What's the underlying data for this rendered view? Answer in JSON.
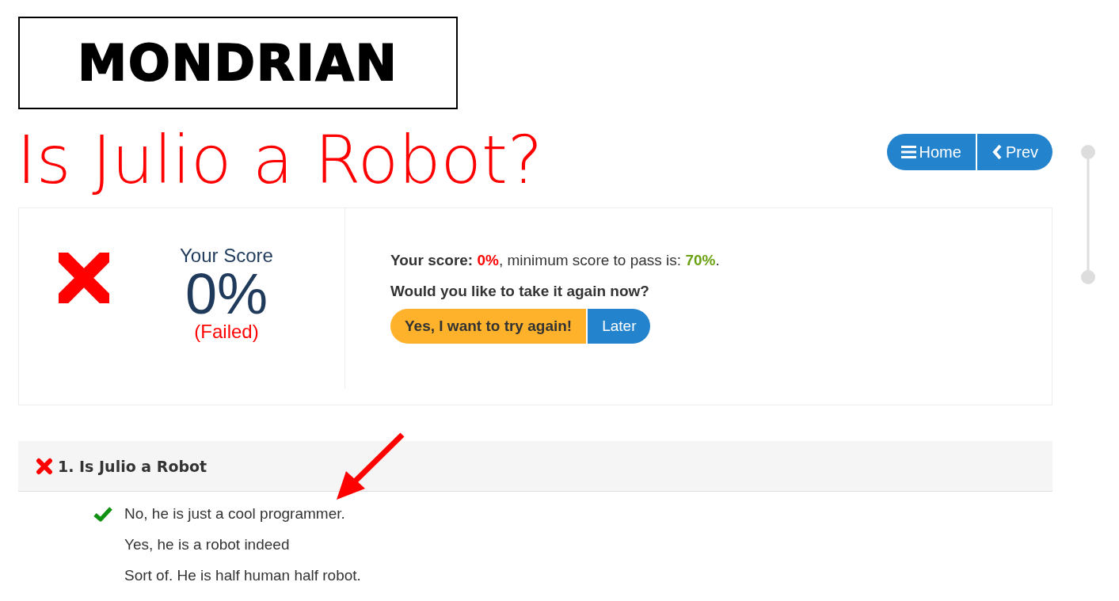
{
  "logo": {
    "text": "MONDRIAN"
  },
  "title": "Is Julio a Robot?",
  "nav_buttons": [
    {
      "kind": "home",
      "label": "Home"
    },
    {
      "kind": "prev",
      "label": "Prev"
    }
  ],
  "result": {
    "passed": false,
    "heading": "Your Score",
    "score": "0%",
    "status": "(Failed)",
    "summary": {
      "label": "Your score:",
      "score": "0%",
      "middle": ", minimum score to pass is: ",
      "pass_mark": "70%",
      "end": "."
    },
    "prompt": "Would you like to take it again now?",
    "buttons": [
      {
        "kind": "retry",
        "label": "Yes, I want to try again!"
      },
      {
        "kind": "later",
        "label": "Later"
      }
    ]
  },
  "questions": [
    {
      "title": "1. Is Julio a Robot",
      "passed": false,
      "answers": [
        {
          "text": "No, he is just a cool programmer.",
          "correct": true
        },
        {
          "text": "Yes, he is a robot indeed",
          "correct": false
        },
        {
          "text": "Sort of. He is half human half robot.",
          "correct": false
        }
      ]
    }
  ]
}
